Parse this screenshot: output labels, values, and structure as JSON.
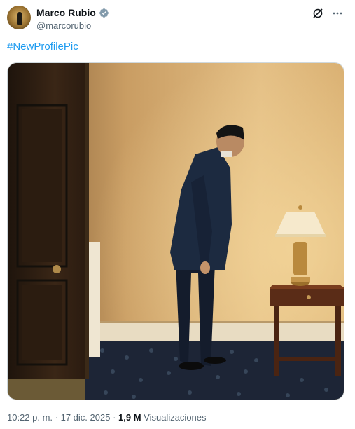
{
  "author": {
    "display_name": "Marco Rubio",
    "handle": "@marcorubio",
    "verified": true
  },
  "icons": {
    "verified": "verified-badge-icon",
    "grok": "grok-icon",
    "more": "more-icon"
  },
  "post": {
    "hashtag": "#NewProfilePic"
  },
  "meta": {
    "time": "10:22 p. m.",
    "separator1": " · ",
    "date": "17 dic. 2025",
    "separator2": " · ",
    "views_count": "1,9 M",
    "views_label": " Visualizaciones"
  },
  "colors": {
    "accent": "#1d9bf0",
    "verified": "#829aab",
    "muted": "#536471"
  }
}
